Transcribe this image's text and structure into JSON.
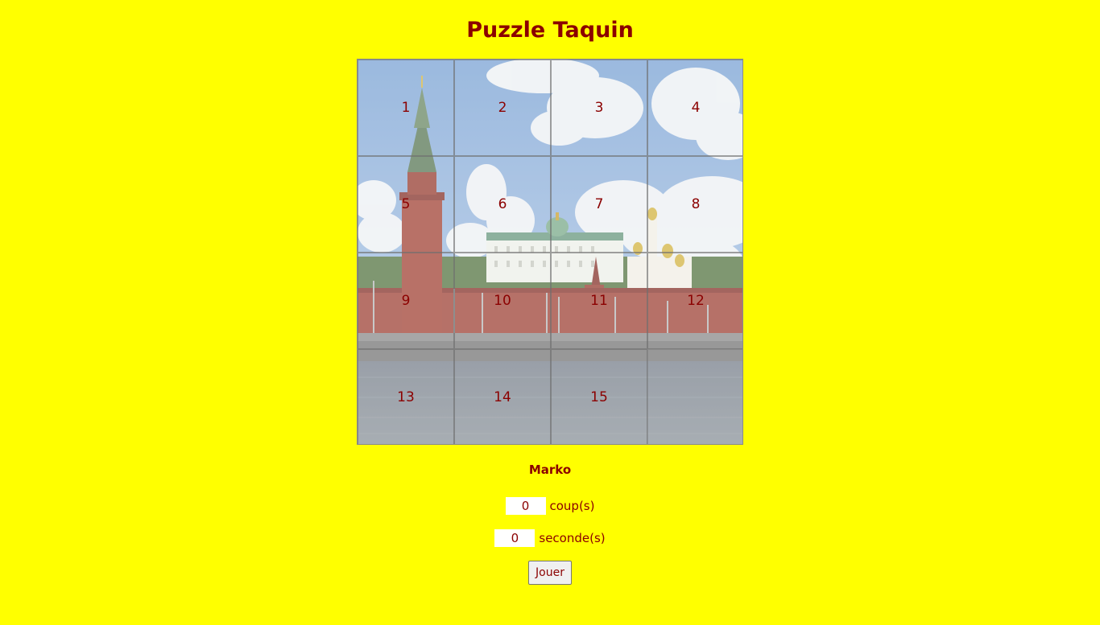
{
  "title": "Puzzle Taquin",
  "board": {
    "image_description": "Moscow Kremlin river view",
    "tiles": [
      "1",
      "2",
      "3",
      "4",
      "5",
      "6",
      "7",
      "8",
      "9",
      "10",
      "11",
      "12",
      "13",
      "14",
      "15",
      ""
    ],
    "empty_index": 15
  },
  "player": "Marko",
  "moves": {
    "value": "0",
    "label": "coup(s)"
  },
  "seconds": {
    "value": "0",
    "label": "seconde(s)"
  },
  "play_button": "Jouer",
  "colors": {
    "background": "#ffff00",
    "text": "#8b0000"
  }
}
